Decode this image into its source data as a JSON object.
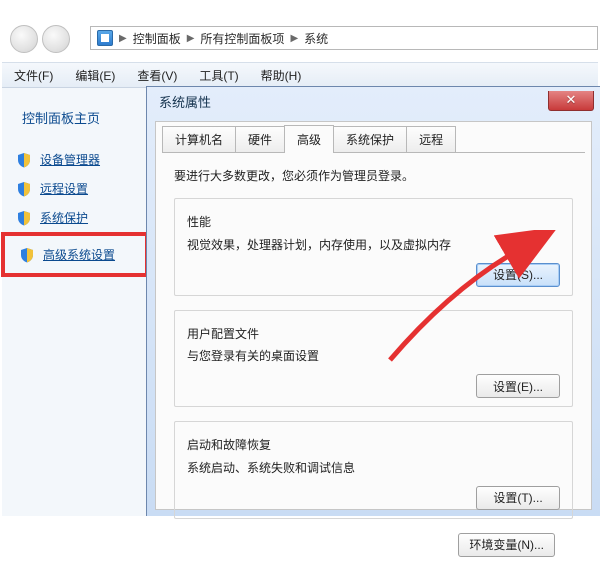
{
  "breadcrumb": {
    "items": [
      "控制面板",
      "所有控制面板项",
      "系统"
    ]
  },
  "menu": {
    "file": "文件(F)",
    "edit": "编辑(E)",
    "view": "查看(V)",
    "tools": "工具(T)",
    "help": "帮助(H)"
  },
  "sidebar": {
    "title": "控制面板主页",
    "items": [
      "设备管理器",
      "远程设置",
      "系统保护",
      "高级系统设置"
    ]
  },
  "dialog": {
    "title": "系统属性",
    "tabs": [
      "计算机名",
      "硬件",
      "高级",
      "系统保护",
      "远程"
    ],
    "admin_note": "要进行大多数更改，您必须作为管理员登录。",
    "groups": {
      "perf": {
        "title": "性能",
        "desc": "视觉效果，处理器计划，内存使用，以及虚拟内存",
        "btn": "设置(S)..."
      },
      "profile": {
        "title": "用户配置文件",
        "desc": "与您登录有关的桌面设置",
        "btn": "设置(E)..."
      },
      "startup": {
        "title": "启动和故障恢复",
        "desc": "系统启动、系统失败和调试信息",
        "btn": "设置(T)..."
      }
    },
    "env_btn": "环境变量(N)..."
  }
}
